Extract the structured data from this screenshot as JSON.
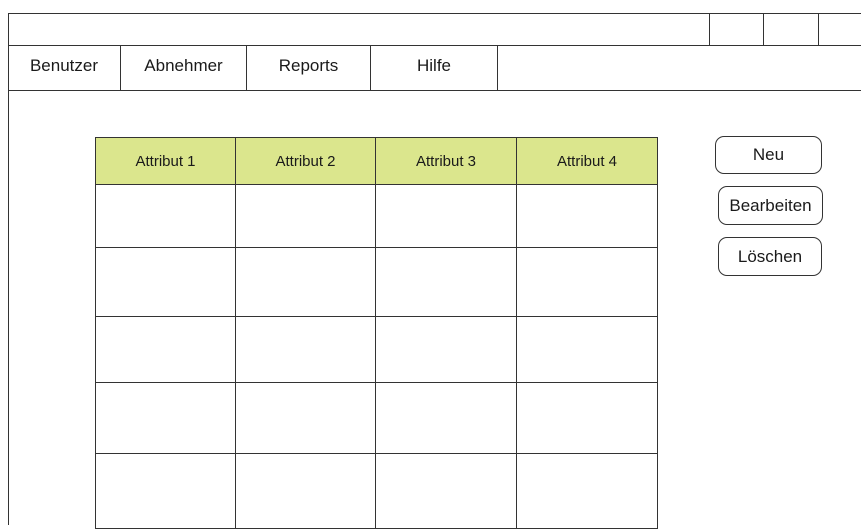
{
  "titlebar": {
    "window_buttons": [
      "",
      "",
      ""
    ]
  },
  "menu": {
    "items": [
      "Benutzer",
      "Abnehmer",
      "Reports",
      "Hilfe"
    ]
  },
  "table": {
    "headers": [
      "Attribut 1",
      "Attribut 2",
      "Attribut 3",
      "Attribut 4"
    ],
    "rows": [
      [
        "",
        "",
        "",
        ""
      ],
      [
        "",
        "",
        "",
        ""
      ],
      [
        "",
        "",
        "",
        ""
      ],
      [
        "",
        "",
        "",
        ""
      ],
      [
        "",
        "",
        "",
        ""
      ]
    ],
    "header_color": "#dbe68d"
  },
  "actions": {
    "new_label": "Neu",
    "edit_label": "Bearbeiten",
    "delete_label": "Löschen"
  }
}
